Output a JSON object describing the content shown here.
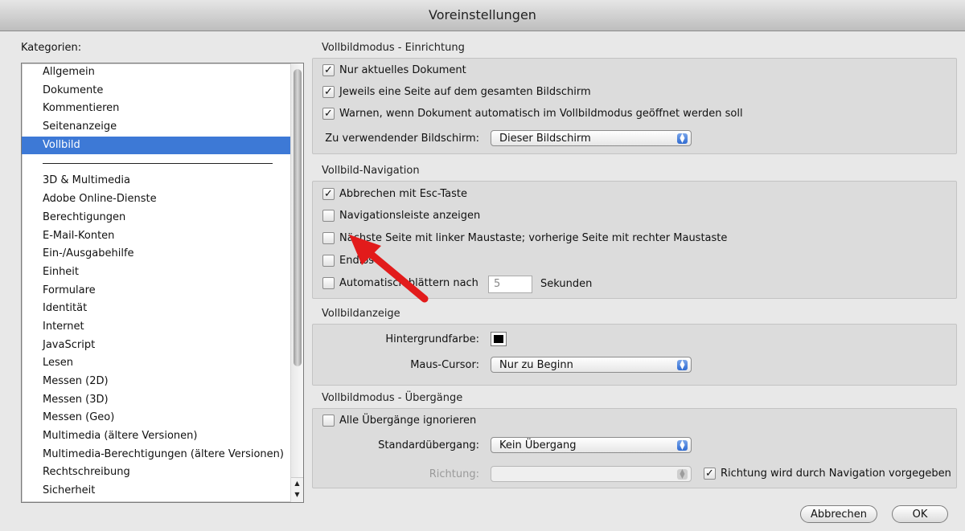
{
  "window": {
    "title": "Voreinstellungen"
  },
  "categories": {
    "label": "Kategorien:",
    "group1": [
      "Allgemein",
      "Dokumente",
      "Kommentieren",
      "Seitenanzeige",
      "Vollbild"
    ],
    "selected": "Vollbild",
    "group2": [
      "3D & Multimedia",
      "Adobe Online-Dienste",
      "Berechtigungen",
      "E-Mail-Konten",
      "Ein-/Ausgabehilfe",
      "Einheit",
      "Formulare",
      "Identität",
      "Internet",
      "JavaScript",
      "Lesen",
      "Messen (2D)",
      "Messen (3D)",
      "Messen (Geo)",
      "Multimedia (ältere Versionen)",
      "Multimedia-Berechtigungen (ältere Versionen)",
      "Rechtschreibung",
      "Sicherheit"
    ]
  },
  "setup": {
    "title": "Vollbildmodus - Einrichtung",
    "only_current_label": "Nur aktuelles Dokument",
    "only_current_checked": true,
    "one_page_label": "Jeweils eine Seite auf dem gesamten Bildschirm",
    "one_page_checked": true,
    "warn_label": "Warnen, wenn Dokument automatisch im Vollbildmodus geöffnet werden soll",
    "warn_checked": true,
    "screen_label": "Zu verwendender Bildschirm:",
    "screen_value": "Dieser Bildschirm"
  },
  "navigation": {
    "title": "Vollbild-Navigation",
    "esc_label": "Abbrechen mit Esc-Taste",
    "esc_checked": true,
    "navbar_label": "Navigationsleiste anzeigen",
    "navbar_checked": false,
    "click_label": "Nächste Seite mit linker Maustaste; vorherige Seite mit rechter Maustaste",
    "click_checked": false,
    "loop_label": "Endlos",
    "loop_checked": false,
    "auto_label": "Automatisch blättern nach",
    "auto_checked": false,
    "auto_seconds": "5",
    "seconds_label": "Sekunden"
  },
  "display": {
    "title": "Vollbildanzeige",
    "bg_label": "Hintergrundfarbe:",
    "bg_color": "#000000",
    "cursor_label": "Maus-Cursor:",
    "cursor_value": "Nur zu Beginn"
  },
  "transitions": {
    "title": "Vollbildmodus - Übergänge",
    "ignore_label": "Alle Übergänge ignorieren",
    "ignore_checked": false,
    "default_label": "Standardübergang:",
    "default_value": "Kein Übergang",
    "direction_label": "Richtung:",
    "direction_value": "",
    "nav_dir_label": "Richtung wird durch Navigation vorgegeben",
    "nav_dir_checked": true
  },
  "buttons": {
    "cancel": "Abbrechen",
    "ok": "OK"
  },
  "colors": {
    "selection": "#3d79d6",
    "annotation_arrow": "#e21b1b"
  }
}
